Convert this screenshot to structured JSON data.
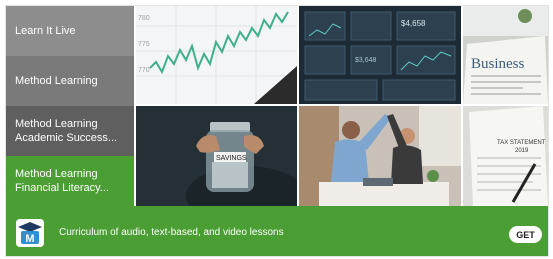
{
  "sidebar": {
    "items": [
      {
        "line1": "Learn It Live",
        "line2": ""
      },
      {
        "line1": "Method Learning",
        "line2": ""
      },
      {
        "line1": "Method Learning",
        "line2": "Academic Success..."
      },
      {
        "line1": "Method Learning",
        "line2": "Financial Literacy..."
      }
    ],
    "selected_index": 3
  },
  "tiles": {
    "chart_labels": [
      "780",
      "775",
      "770"
    ],
    "dashboard_value": "$4,658",
    "dashboard_value_2": "$3,648",
    "newspaper_headline": "Business",
    "jar_label": "SAVINGS",
    "tax_heading": "TAX STATEMENT",
    "tax_year": "2019"
  },
  "bottom": {
    "description": "Curriculum of audio, text-based, and video lessons",
    "get_label": "GET",
    "app_icon_letter": "M"
  },
  "colors": {
    "accent": "#4a9e33",
    "chart_line": "#3fb08a"
  }
}
